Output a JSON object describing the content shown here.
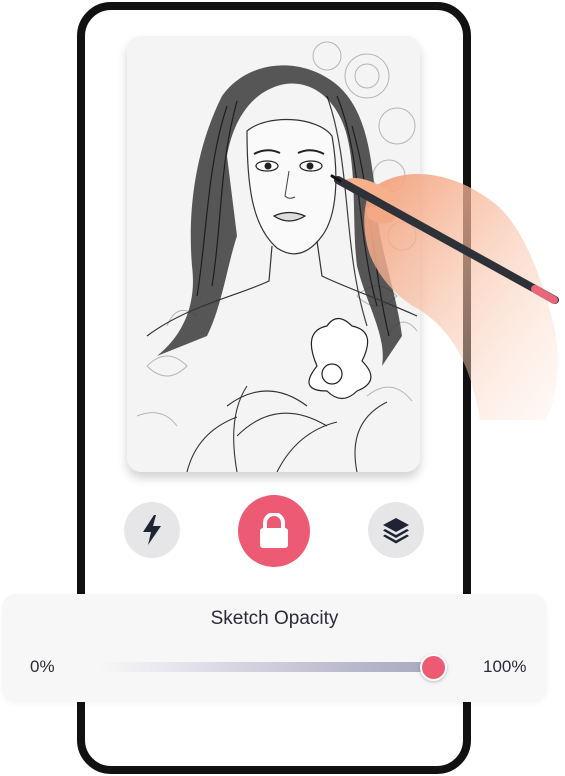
{
  "canvas": {
    "image": "line-art-woman-portrait-with-flowers"
  },
  "controls": {
    "flash_icon": "lightning-bolt-icon",
    "lock_icon": "lock-icon",
    "layers_icon": "layers-icon",
    "accent_color": "#ec5b73",
    "button_bg": "#e6e6e8"
  },
  "opacity_panel": {
    "title": "Sketch Opacity",
    "min_label": "0%",
    "max_label": "100%",
    "value": 1.0
  }
}
